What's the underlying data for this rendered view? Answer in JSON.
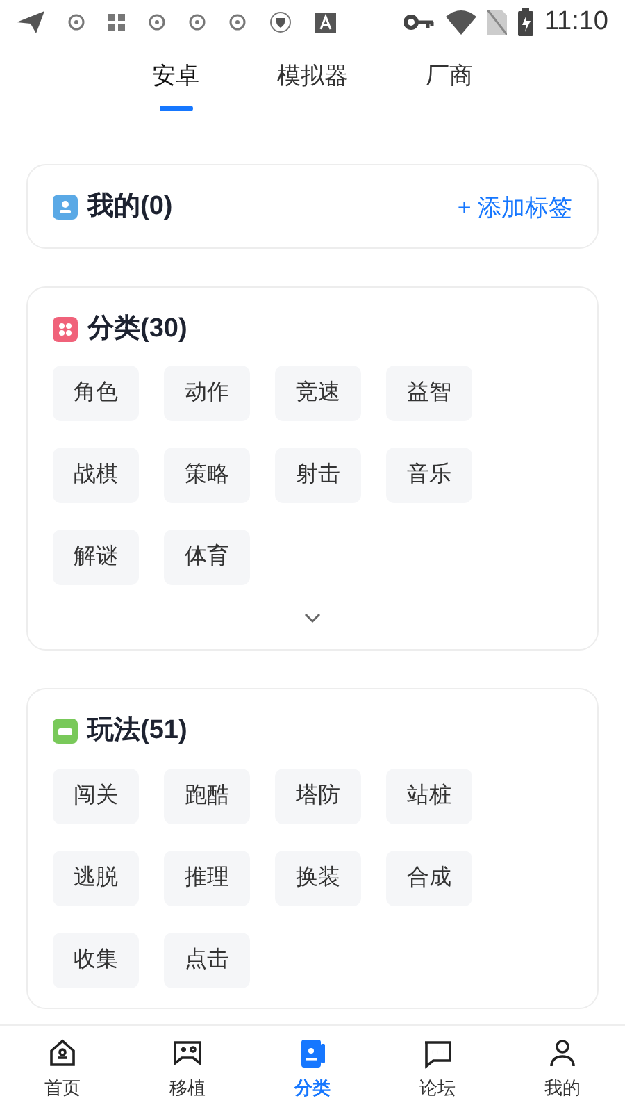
{
  "status_bar": {
    "time": "11:10"
  },
  "tabs": [
    {
      "label": "安卓",
      "selected": true
    },
    {
      "label": "模拟器",
      "selected": false
    },
    {
      "label": "厂商",
      "selected": false
    }
  ],
  "sections": [
    {
      "kind": "mine",
      "title": "我的(0)",
      "action": "+ 添加标签"
    },
    {
      "kind": "category",
      "title": "分类(30)",
      "expandable": true,
      "tags": [
        "角色",
        "动作",
        "竞速",
        "益智",
        "战棋",
        "策略",
        "射击",
        "音乐",
        "解谜",
        "体育"
      ]
    },
    {
      "kind": "gameplay",
      "title": "玩法(51)",
      "expandable": false,
      "tags": [
        "闯关",
        "跑酷",
        "塔防",
        "站桩",
        "逃脱",
        "推理",
        "换装",
        "合成",
        "收集",
        "点击"
      ]
    }
  ],
  "bottom_nav": [
    {
      "label": "首页",
      "kind": "home",
      "selected": false
    },
    {
      "label": "移植",
      "kind": "gamepad",
      "selected": false
    },
    {
      "label": "分类",
      "kind": "category",
      "selected": true
    },
    {
      "label": "论坛",
      "kind": "chat",
      "selected": false
    },
    {
      "label": "我的",
      "kind": "person",
      "selected": false
    }
  ]
}
